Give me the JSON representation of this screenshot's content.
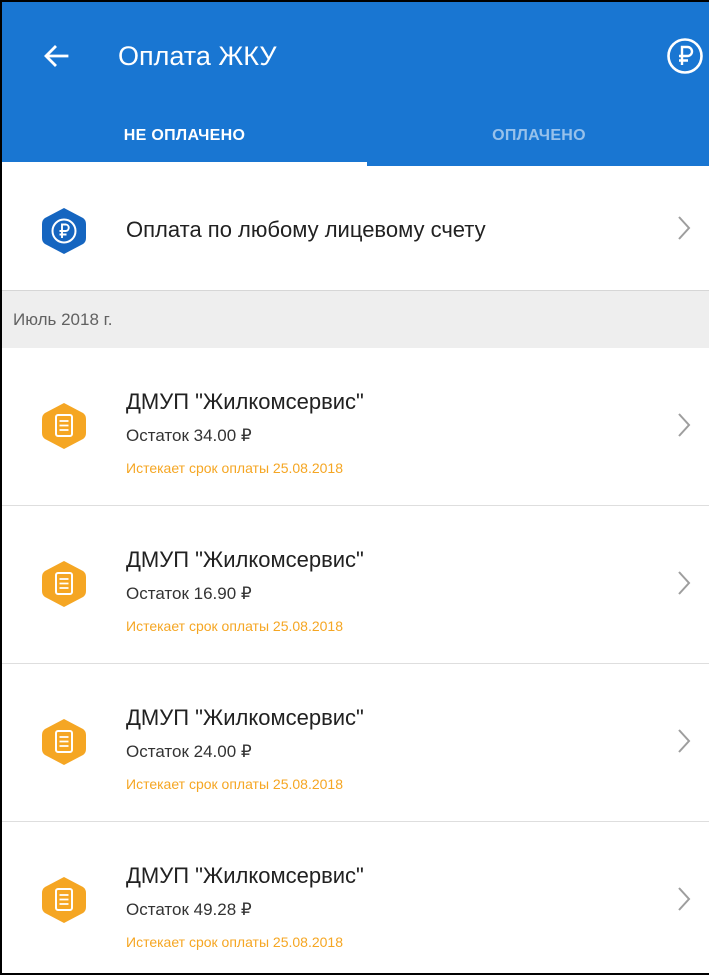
{
  "header": {
    "title": "Оплата ЖКУ",
    "back_icon": "arrow-left-icon",
    "action_icon": "ruble-circle-icon"
  },
  "tabs": [
    {
      "label": "НЕ ОПЛАЧЕНО",
      "active": true
    },
    {
      "label": "ОПЛАЧЕНО",
      "active": false
    }
  ],
  "any_account": {
    "label": "Оплата по любому лицевому счету",
    "icon": "ruble-hexagon-icon"
  },
  "section": {
    "label": "Июль 2018 г."
  },
  "bills": [
    {
      "name": "ДМУП \"Жилкомсервис\"",
      "balance": "Остаток 34.00 ₽",
      "due": "Истекает срок оплаты 25.08.2018"
    },
    {
      "name": "ДМУП \"Жилкомсервис\"",
      "balance": "Остаток 16.90 ₽",
      "due": "Истекает срок оплаты 25.08.2018"
    },
    {
      "name": "ДМУП \"Жилкомсервис\"",
      "balance": "Остаток 24.00 ₽",
      "due": "Истекает срок оплаты 25.08.2018"
    },
    {
      "name": "ДМУП \"Жилкомсервис\"",
      "balance": "Остаток 49.28 ₽",
      "due": "Истекает срок оплаты 25.08.2018"
    }
  ],
  "colors": {
    "primary": "#1976d2",
    "accent_orange": "#f5a623",
    "hex_blue": "#1565c0"
  }
}
